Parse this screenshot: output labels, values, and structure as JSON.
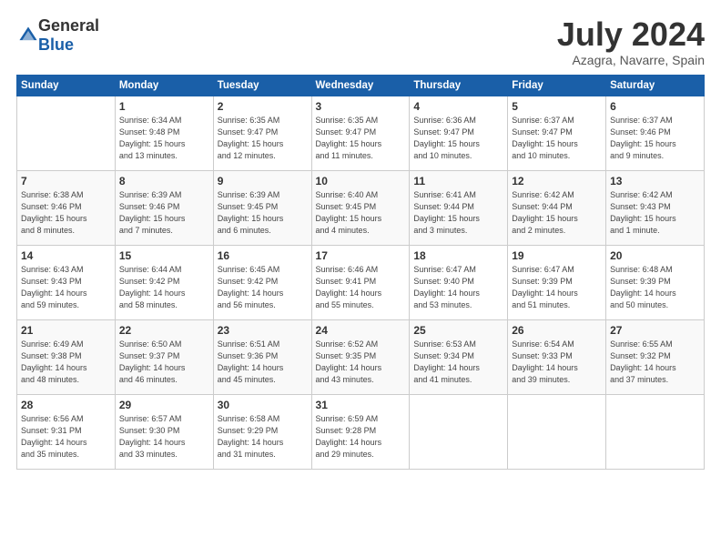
{
  "header": {
    "logo_general": "General",
    "logo_blue": "Blue",
    "month_year": "July 2024",
    "location": "Azagra, Navarre, Spain"
  },
  "days_of_week": [
    "Sunday",
    "Monday",
    "Tuesday",
    "Wednesday",
    "Thursday",
    "Friday",
    "Saturday"
  ],
  "weeks": [
    [
      {
        "day": "",
        "info": ""
      },
      {
        "day": "1",
        "info": "Sunrise: 6:34 AM\nSunset: 9:48 PM\nDaylight: 15 hours\nand 13 minutes."
      },
      {
        "day": "2",
        "info": "Sunrise: 6:35 AM\nSunset: 9:47 PM\nDaylight: 15 hours\nand 12 minutes."
      },
      {
        "day": "3",
        "info": "Sunrise: 6:35 AM\nSunset: 9:47 PM\nDaylight: 15 hours\nand 11 minutes."
      },
      {
        "day": "4",
        "info": "Sunrise: 6:36 AM\nSunset: 9:47 PM\nDaylight: 15 hours\nand 10 minutes."
      },
      {
        "day": "5",
        "info": "Sunrise: 6:37 AM\nSunset: 9:47 PM\nDaylight: 15 hours\nand 10 minutes."
      },
      {
        "day": "6",
        "info": "Sunrise: 6:37 AM\nSunset: 9:46 PM\nDaylight: 15 hours\nand 9 minutes."
      }
    ],
    [
      {
        "day": "7",
        "info": "Sunrise: 6:38 AM\nSunset: 9:46 PM\nDaylight: 15 hours\nand 8 minutes."
      },
      {
        "day": "8",
        "info": "Sunrise: 6:39 AM\nSunset: 9:46 PM\nDaylight: 15 hours\nand 7 minutes."
      },
      {
        "day": "9",
        "info": "Sunrise: 6:39 AM\nSunset: 9:45 PM\nDaylight: 15 hours\nand 6 minutes."
      },
      {
        "day": "10",
        "info": "Sunrise: 6:40 AM\nSunset: 9:45 PM\nDaylight: 15 hours\nand 4 minutes."
      },
      {
        "day": "11",
        "info": "Sunrise: 6:41 AM\nSunset: 9:44 PM\nDaylight: 15 hours\nand 3 minutes."
      },
      {
        "day": "12",
        "info": "Sunrise: 6:42 AM\nSunset: 9:44 PM\nDaylight: 15 hours\nand 2 minutes."
      },
      {
        "day": "13",
        "info": "Sunrise: 6:42 AM\nSunset: 9:43 PM\nDaylight: 15 hours\nand 1 minute."
      }
    ],
    [
      {
        "day": "14",
        "info": "Sunrise: 6:43 AM\nSunset: 9:43 PM\nDaylight: 14 hours\nand 59 minutes."
      },
      {
        "day": "15",
        "info": "Sunrise: 6:44 AM\nSunset: 9:42 PM\nDaylight: 14 hours\nand 58 minutes."
      },
      {
        "day": "16",
        "info": "Sunrise: 6:45 AM\nSunset: 9:42 PM\nDaylight: 14 hours\nand 56 minutes."
      },
      {
        "day": "17",
        "info": "Sunrise: 6:46 AM\nSunset: 9:41 PM\nDaylight: 14 hours\nand 55 minutes."
      },
      {
        "day": "18",
        "info": "Sunrise: 6:47 AM\nSunset: 9:40 PM\nDaylight: 14 hours\nand 53 minutes."
      },
      {
        "day": "19",
        "info": "Sunrise: 6:47 AM\nSunset: 9:39 PM\nDaylight: 14 hours\nand 51 minutes."
      },
      {
        "day": "20",
        "info": "Sunrise: 6:48 AM\nSunset: 9:39 PM\nDaylight: 14 hours\nand 50 minutes."
      }
    ],
    [
      {
        "day": "21",
        "info": "Sunrise: 6:49 AM\nSunset: 9:38 PM\nDaylight: 14 hours\nand 48 minutes."
      },
      {
        "day": "22",
        "info": "Sunrise: 6:50 AM\nSunset: 9:37 PM\nDaylight: 14 hours\nand 46 minutes."
      },
      {
        "day": "23",
        "info": "Sunrise: 6:51 AM\nSunset: 9:36 PM\nDaylight: 14 hours\nand 45 minutes."
      },
      {
        "day": "24",
        "info": "Sunrise: 6:52 AM\nSunset: 9:35 PM\nDaylight: 14 hours\nand 43 minutes."
      },
      {
        "day": "25",
        "info": "Sunrise: 6:53 AM\nSunset: 9:34 PM\nDaylight: 14 hours\nand 41 minutes."
      },
      {
        "day": "26",
        "info": "Sunrise: 6:54 AM\nSunset: 9:33 PM\nDaylight: 14 hours\nand 39 minutes."
      },
      {
        "day": "27",
        "info": "Sunrise: 6:55 AM\nSunset: 9:32 PM\nDaylight: 14 hours\nand 37 minutes."
      }
    ],
    [
      {
        "day": "28",
        "info": "Sunrise: 6:56 AM\nSunset: 9:31 PM\nDaylight: 14 hours\nand 35 minutes."
      },
      {
        "day": "29",
        "info": "Sunrise: 6:57 AM\nSunset: 9:30 PM\nDaylight: 14 hours\nand 33 minutes."
      },
      {
        "day": "30",
        "info": "Sunrise: 6:58 AM\nSunset: 9:29 PM\nDaylight: 14 hours\nand 31 minutes."
      },
      {
        "day": "31",
        "info": "Sunrise: 6:59 AM\nSunset: 9:28 PM\nDaylight: 14 hours\nand 29 minutes."
      },
      {
        "day": "",
        "info": ""
      },
      {
        "day": "",
        "info": ""
      },
      {
        "day": "",
        "info": ""
      }
    ]
  ]
}
